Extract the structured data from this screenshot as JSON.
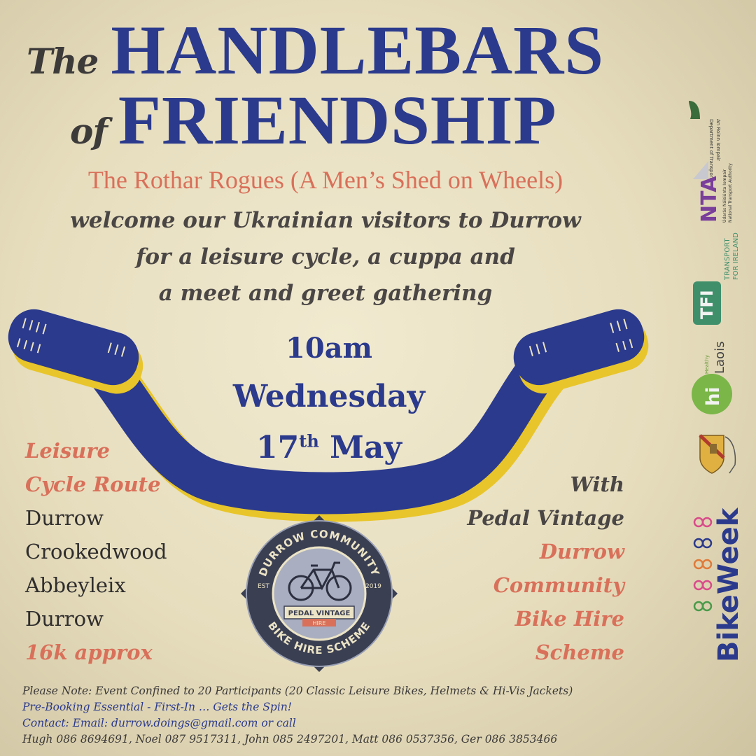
{
  "title": {
    "line1_small": "The",
    "line1_big": "HANDLEBARS",
    "line2_small": "of",
    "line2_big": "FRIENDSHIP"
  },
  "subtitle": "The Rothar Rogues (A Men’s Shed on Wheels)",
  "welcome": [
    "welcome our Ukrainian visitors to Durrow",
    "for a leisure cycle, a cuppa and",
    "a meet and greet gathering"
  ],
  "event": {
    "time": "10am",
    "day": "Wednesday",
    "date_num": "17",
    "date_suffix": "th",
    "month": "May"
  },
  "route": {
    "heading1": "Leisure",
    "heading2": "Cycle Route",
    "stops": [
      "Durrow",
      "Crookedwood",
      "Abbeyleix",
      "Durrow"
    ],
    "distance": "16k approx"
  },
  "partners": {
    "with": "With",
    "pedal": "Pedal Vintage",
    "scheme": [
      "Durrow",
      "Community",
      "Bike Hire",
      "Scheme"
    ]
  },
  "badge": {
    "top_text": "DURROW COMMUNITY",
    "bottom_text": "BIKE HIRE SCHEME",
    "est": "EST",
    "year": "2019",
    "ribbon": "PEDAL VINTAGE",
    "ribbon_sub": "HIRE"
  },
  "notes": {
    "line1": "Please Note: Event Confined to 20 Participants (20 Classic Leisure Bikes, Helmets & Hi-Vis Jackets)",
    "line2": "Pre-Booking Essential - First-In … Gets the Spin!",
    "line3": "Contact: Email: durrow.doings@gmail.com or call",
    "line4": "Hugh 086 8694691, Noel 087 9517311,  John 085 2497201, Matt 086 0537356, Ger 086 3853466"
  },
  "sponsors": {
    "dept_line1": "An Roinn Iompair",
    "dept_line2": "Department of Transport",
    "nta": "NTA",
    "nta_sub1": "Údarás Náisiúnta Iompair",
    "nta_sub2": "National Transport Authority",
    "tfi": "TFI",
    "tfi_sub1": "TRANSPORT",
    "tfi_sub2": "FOR IRELAND",
    "laois": "Laois",
    "healthy": "Healthy",
    "hi": "hi",
    "bikeweek": "BikeWeek"
  },
  "colors": {
    "navy": "#2b3a8c",
    "coral": "#d9705a",
    "yellow": "#e8c52a",
    "paper": "#ece4c6"
  }
}
